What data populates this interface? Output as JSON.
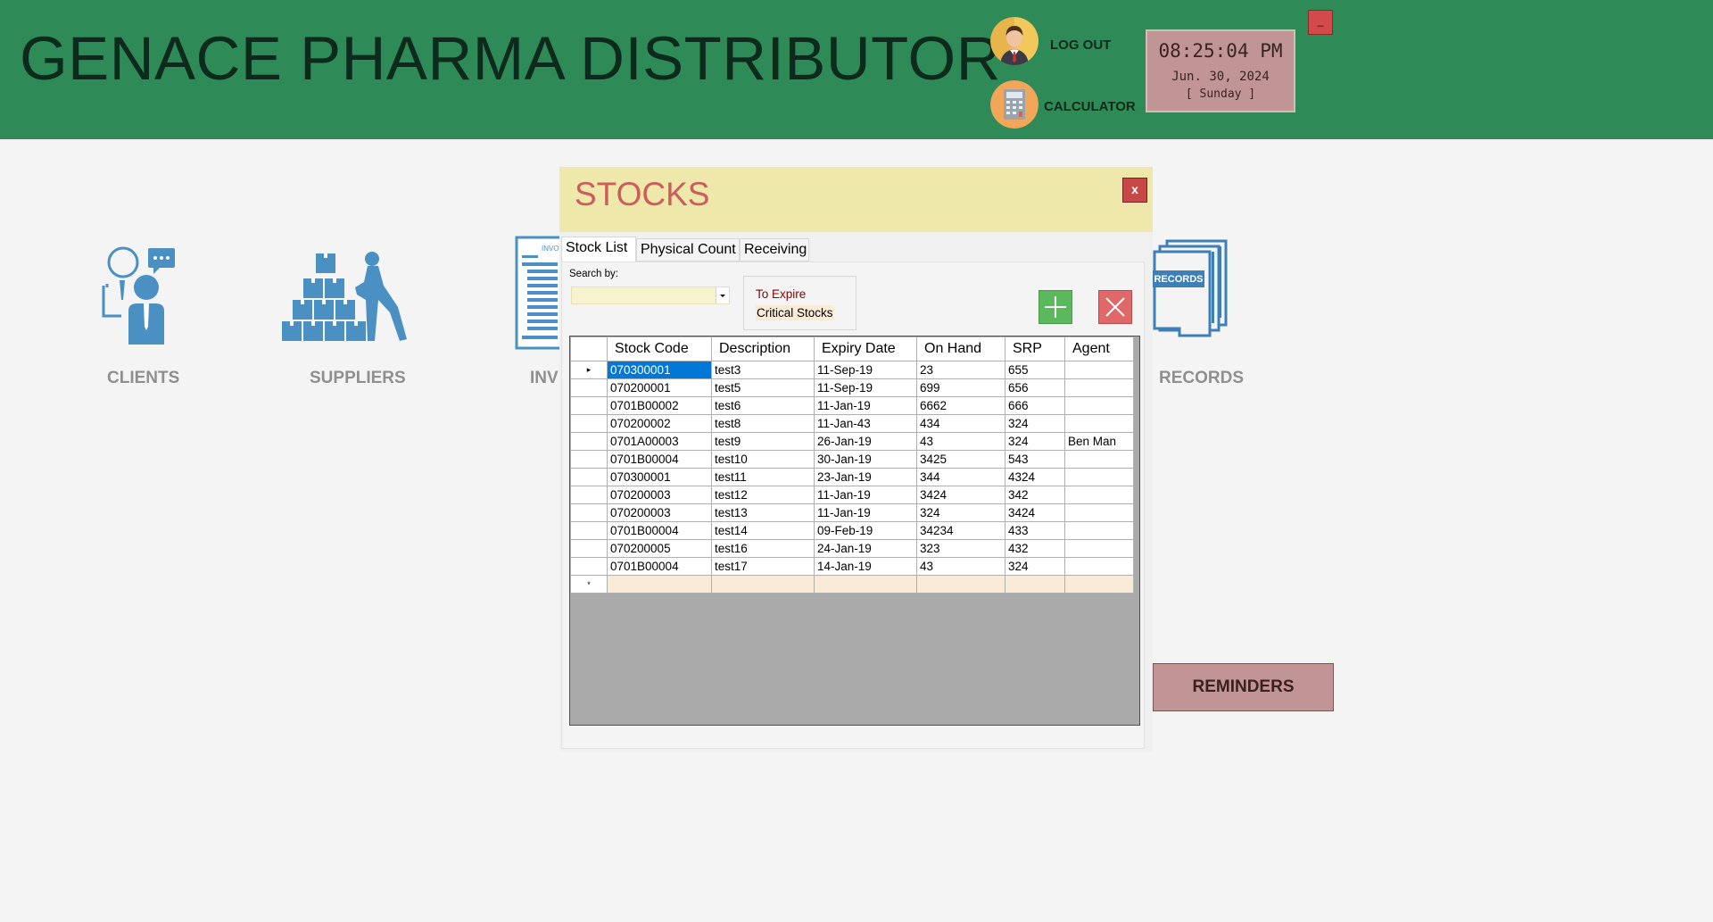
{
  "header": {
    "title": "GENACE PHARMA DISTRIBUTOR",
    "logout_label": "LOG OUT",
    "calculator_label": "CALCULATOR",
    "clock": {
      "time": "08:25:04 PM",
      "date": "Jun. 30, 2024",
      "day": "[ Sunday ]"
    },
    "minimize_label": "_"
  },
  "modules": {
    "clients": "CLIENTS",
    "suppliers": "SUPPLIERS",
    "inventory": "INV",
    "inventory_icon_text": "INVO",
    "records": "RECORDS",
    "records_icon_text": "RECORDS"
  },
  "reminders_label": "REMINDERS",
  "dialog": {
    "title": "STOCKS",
    "close_label": "x",
    "tabs": [
      "Stock List",
      "Physical Count",
      "Receiving"
    ],
    "search_label": "Search by:",
    "filters": [
      "To Expire",
      "Critical Stocks"
    ],
    "grid": {
      "columns": [
        "Stock Code",
        "Description",
        "Expiry Date",
        "On Hand",
        "SRP",
        "Agent"
      ],
      "rows": [
        [
          "070300001",
          "test3",
          "11-Sep-19",
          "23",
          "655",
          ""
        ],
        [
          "070200001",
          "test5",
          "11-Sep-19",
          "699",
          "656",
          ""
        ],
        [
          "0701B00002",
          "test6",
          "11-Jan-19",
          "6662",
          "666",
          ""
        ],
        [
          "070200002",
          "test8",
          "11-Jan-43",
          "434",
          "324",
          ""
        ],
        [
          "0701A00003",
          "test9",
          "26-Jan-19",
          "43",
          "324",
          "Ben Man"
        ],
        [
          "0701B00004",
          "test10",
          "30-Jan-19",
          "3425",
          "543",
          ""
        ],
        [
          "070300001",
          "test11",
          "23-Jan-19",
          "344",
          "4324",
          ""
        ],
        [
          "070200003",
          "test12",
          "11-Jan-19",
          "3424",
          "342",
          ""
        ],
        [
          "070200003",
          "test13",
          "11-Jan-19",
          "324",
          "3424",
          ""
        ],
        [
          "0701B00004",
          "test14",
          "09-Feb-19",
          "34234",
          "433",
          ""
        ],
        [
          "070200005",
          "test16",
          "24-Jan-19",
          "323",
          "432",
          ""
        ],
        [
          "0701B00004",
          "test17",
          "14-Jan-19",
          "43",
          "324",
          ""
        ]
      ],
      "new_row_marker": "*",
      "current_row_marker": "▸"
    }
  },
  "colors": {
    "header_bg": "#2e8b57",
    "module_icon": "#4a90c2",
    "dialog_header": "#eee8aa",
    "dialog_title": "#cd5c5c",
    "selection": "#0078d7",
    "reminders_bg": "#c19595"
  },
  "icons": [
    "user-avatar-icon",
    "calculator-icon",
    "clients-icon",
    "suppliers-icon",
    "invoice-icon",
    "records-icon",
    "plus-icon",
    "x-icon",
    "dropdown-arrow-icon"
  ]
}
